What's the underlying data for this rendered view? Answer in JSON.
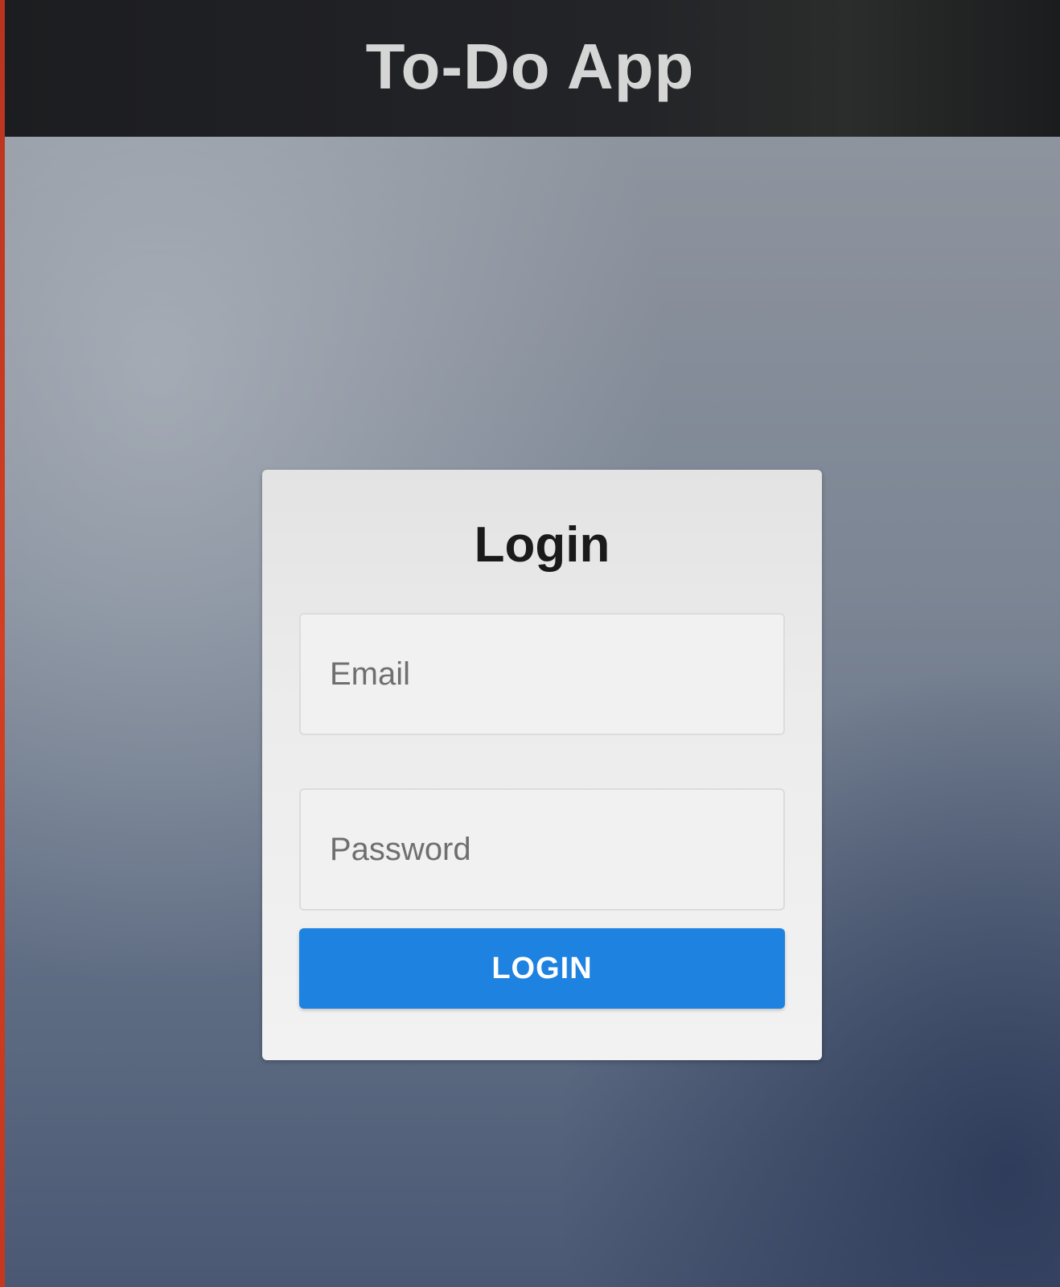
{
  "header": {
    "title": "To-Do App"
  },
  "login": {
    "heading": "Login",
    "email_placeholder": "Email",
    "password_placeholder": "Password",
    "submit_label": "LOGIN"
  },
  "colors": {
    "header_bg": "#1c1d20",
    "primary_button": "#1e82e0",
    "card_bg": "#ececec"
  }
}
